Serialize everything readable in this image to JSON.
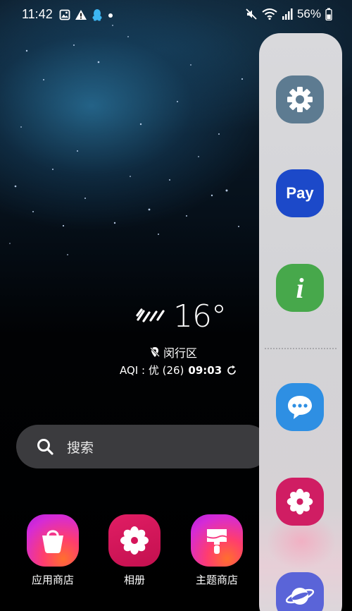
{
  "status_bar": {
    "time": "11:42",
    "left_icons": [
      "gallery-icon",
      "alert-icon",
      "qq-icon",
      "dot-icon"
    ],
    "right_icons": [
      "mute-icon",
      "wifi-icon",
      "signal-icon",
      "battery-icon"
    ],
    "battery": "56%"
  },
  "weather": {
    "temperature": "16°",
    "location": "闵行区",
    "aqi": "AQI : 优 (26)",
    "updated_time": "09:03"
  },
  "search": {
    "label": "搜索"
  },
  "dock": [
    {
      "label": "应用商店",
      "icon": "store-icon"
    },
    {
      "label": "相册",
      "icon": "gallery-flower-icon"
    },
    {
      "label": "主题商店",
      "icon": "theme-brush-icon"
    }
  ],
  "edge_panel": {
    "apps": [
      {
        "name": "settings",
        "icon": "gear-icon",
        "color": "#5d7b91"
      },
      {
        "name": "pay",
        "icon_text": "Pay",
        "color": "#1c49c9"
      },
      {
        "name": "tips",
        "icon_text": "i",
        "color": "#47a84b"
      },
      {
        "name": "messages",
        "icon": "chat-bubble-icon",
        "color": "#2e8fe3"
      },
      {
        "name": "gallery",
        "icon": "flower-icon",
        "color": "#d01d63"
      },
      {
        "name": "internet",
        "icon": "planet-icon",
        "color": "#5a64d8"
      }
    ]
  },
  "colors": {
    "search_bg": "#3b3b3e",
    "edge_panel_bg": "#d9d9dc"
  }
}
